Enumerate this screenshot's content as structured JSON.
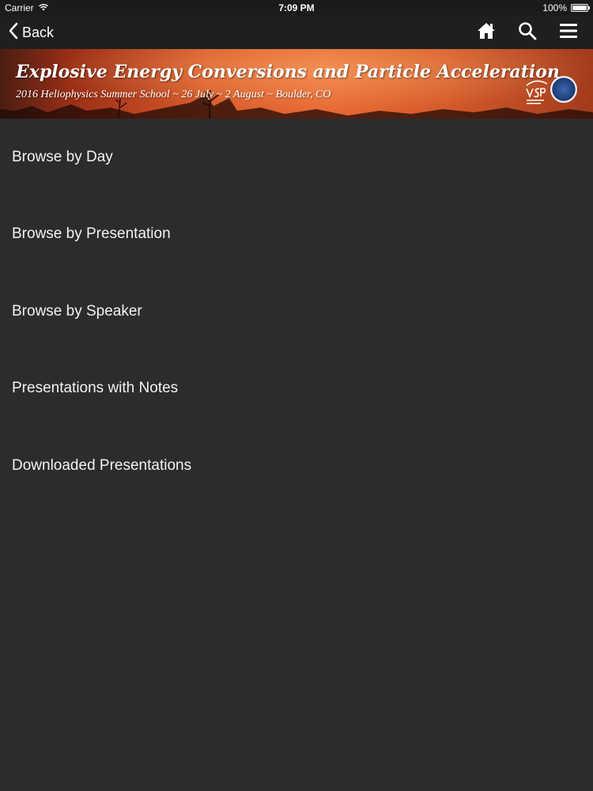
{
  "status_bar": {
    "carrier": "Carrier",
    "time": "7:09 PM",
    "battery": "100%",
    "battery_level": 1.0
  },
  "nav": {
    "back_label": "Back",
    "icons": [
      "home-icon",
      "search-icon",
      "hamburger-menu-icon"
    ]
  },
  "banner": {
    "title": "Explosive Energy Conversions and Particle Acceleration",
    "subtitle": "2016 Heliophysics Summer School ~ 26 July ~ 2 August ~ Boulder, CO",
    "logos": [
      "vsp-logo",
      "organization-seal"
    ]
  },
  "menu": {
    "items": [
      {
        "label": "Browse by Day"
      },
      {
        "label": "Browse by Presentation"
      },
      {
        "label": "Browse by Speaker"
      },
      {
        "label": "Presentations with Notes"
      },
      {
        "label": "Downloaded Presentations"
      }
    ]
  },
  "colors": {
    "background": "#2b2c2e",
    "navbar": "#1f1f1f",
    "banner_accent": "#d95a2a",
    "text": "#ffffff"
  }
}
